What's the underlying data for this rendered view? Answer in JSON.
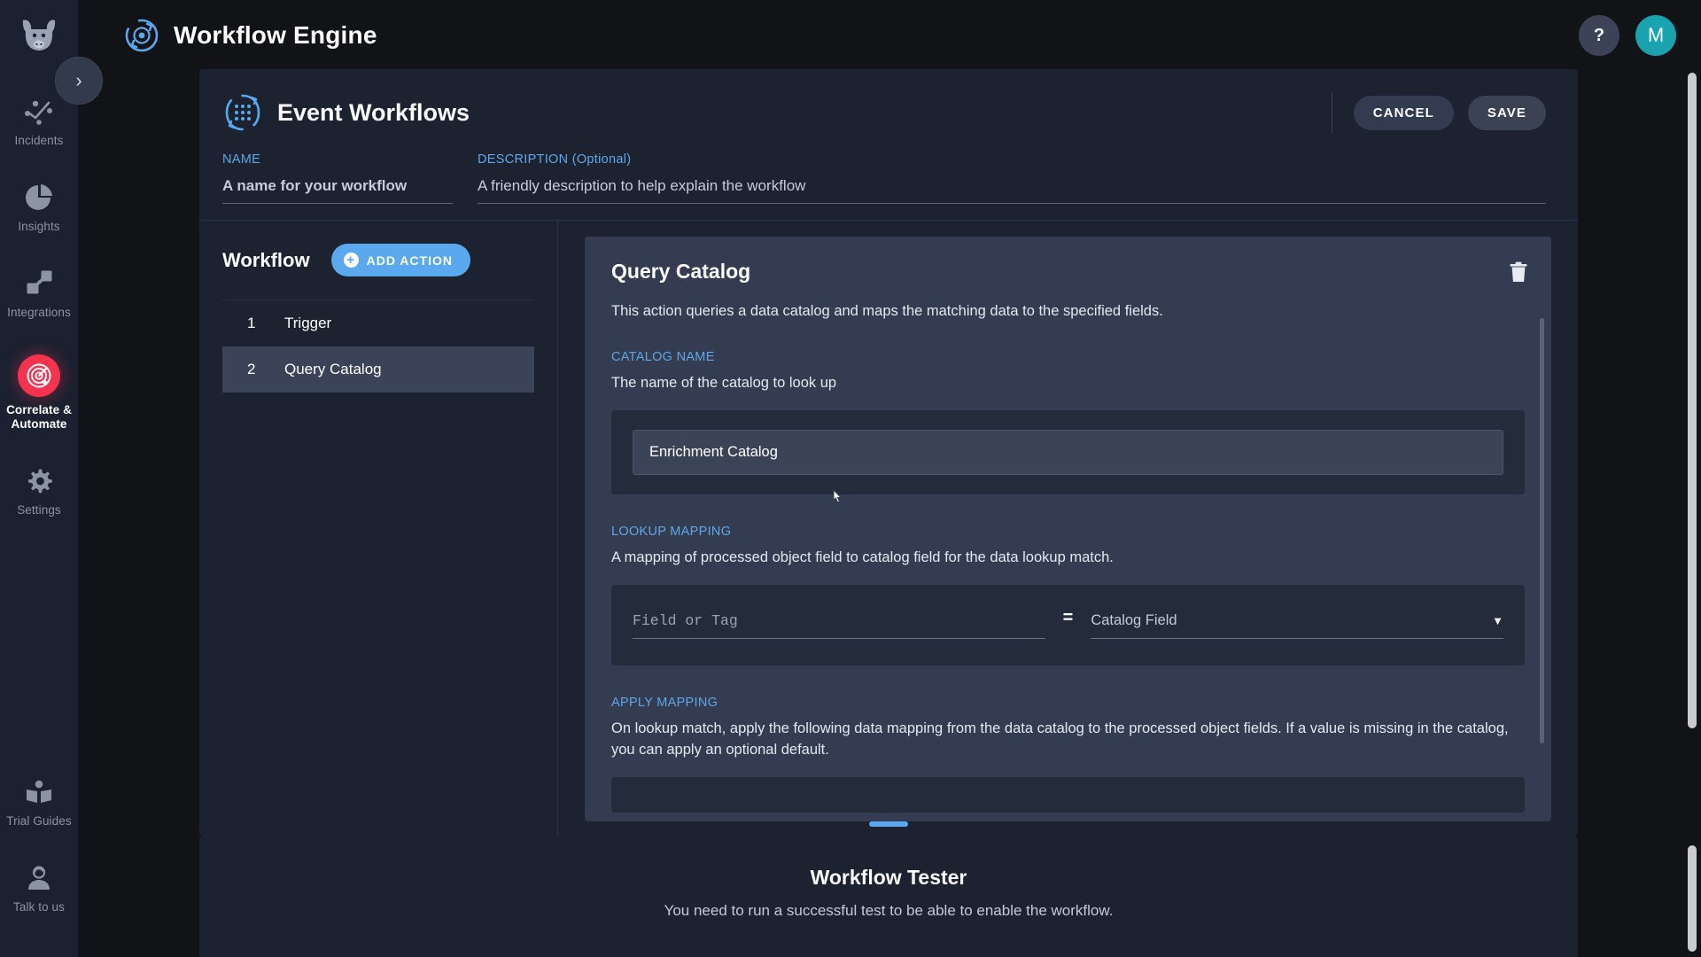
{
  "sidebar": {
    "logo_icon": "cow-head-logo-icon",
    "toggle_icon": "chevron-right-icon",
    "items": [
      {
        "label": "Incidents",
        "icon": "incidents-nodes-icon",
        "active": false
      },
      {
        "label": "Insights",
        "icon": "pie-chart-icon",
        "active": false
      },
      {
        "label": "Integrations",
        "icon": "integrations-link-icon",
        "active": false
      },
      {
        "label": "Correlate & Automate",
        "icon": "radar-target-icon",
        "active": true
      },
      {
        "label": "Settings",
        "icon": "gear-icon",
        "active": false
      }
    ],
    "bottom_items": [
      {
        "label": "Trial Guides",
        "icon": "open-book-icon"
      },
      {
        "label": "Talk to us",
        "icon": "support-agent-icon"
      }
    ]
  },
  "topbar": {
    "logo_icon": "workflow-engine-icon",
    "title": "Workflow Engine",
    "help_label": "?",
    "avatar_initial": "M"
  },
  "panel": {
    "icon": "event-workflows-icon",
    "title": "Event Workflows",
    "cancel_label": "CANCEL",
    "save_label": "SAVE",
    "name_field": {
      "label": "NAME",
      "value": "",
      "placeholder": "A name for your workflow"
    },
    "description_field": {
      "label": "DESCRIPTION (Optional)",
      "value": "",
      "placeholder": "A friendly description to help explain the workflow"
    }
  },
  "workflow": {
    "title": "Workflow",
    "add_action_label": "ADD ACTION",
    "steps": [
      {
        "number": "1",
        "name": "Trigger",
        "selected": false
      },
      {
        "number": "2",
        "name": "Query Catalog",
        "selected": true
      }
    ]
  },
  "action": {
    "title": "Query Catalog",
    "delete_icon": "trash-icon",
    "description": "This action queries a data catalog and maps the matching data to the specified fields.",
    "catalog_name": {
      "label": "CATALOG NAME",
      "description": "The name of the catalog to look up",
      "selected_value": "Enrichment Catalog"
    },
    "lookup_mapping": {
      "label": "LOOKUP MAPPING",
      "description": "A mapping of processed object field to catalog field for the data lookup match.",
      "field_placeholder": "Field or Tag",
      "field_value": "",
      "equals_symbol": "=",
      "catalog_field_placeholder": "Catalog Field",
      "catalog_field_value": "",
      "dropdown_icon": "chevron-down-icon"
    },
    "apply_mapping": {
      "label": "APPLY MAPPING",
      "description": "On lookup match, apply the following data mapping from the data catalog to the processed object fields. If a value is missing in the catalog, you can apply an optional default."
    }
  },
  "tester": {
    "grabber_icon": "drag-handle-icon",
    "title": "Workflow Tester",
    "subtitle": "You need to run a successful test to be able to enable the workflow."
  },
  "colors": {
    "accent_blue": "#5aa9ef",
    "label_blue": "#61a6e8",
    "active_red": "#f5334f",
    "avatar_teal": "#19a3ae",
    "panel_bg": "#1c2230",
    "card_bg": "#333c50"
  }
}
